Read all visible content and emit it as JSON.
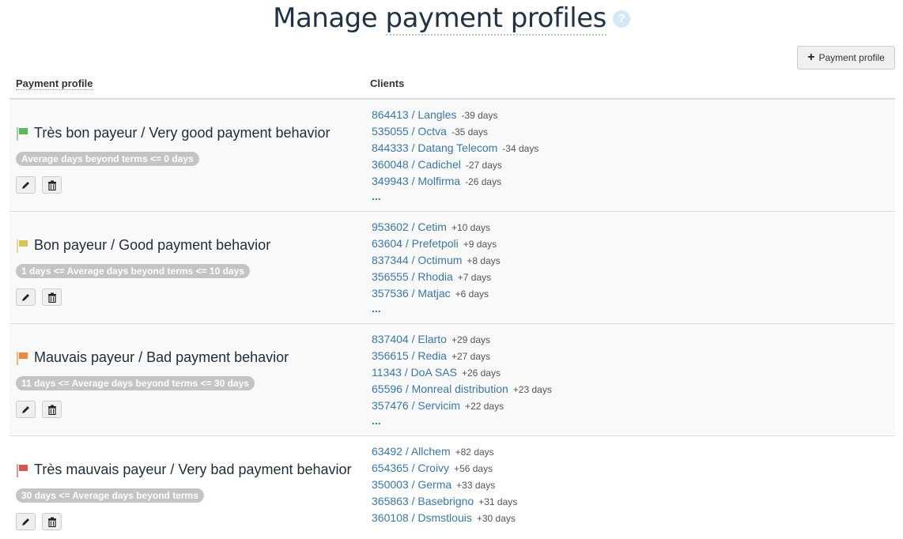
{
  "header": {
    "title_part1": "Manage ",
    "title_part2": "payment profiles",
    "help_icon": "question-circle-icon",
    "help_glyph": "?"
  },
  "toolbar": {
    "add_icon": "plus-icon",
    "add_glyph": "+",
    "add_label": "Payment profile"
  },
  "table": {
    "headers": {
      "profile": "Payment profile",
      "clients": "Clients"
    },
    "more_label": "...",
    "rows": [
      {
        "name": "Très bon payeur / Very good payment behavior",
        "flag_color": "#5cb85c",
        "criteria": "Average days beyond terms <= 0 days",
        "clients": [
          {
            "label": "864413 / Langles",
            "days": "-39 days"
          },
          {
            "label": "535055 / Octva",
            "days": "-35 days"
          },
          {
            "label": "844333 / Datang Telecom",
            "days": "-34 days"
          },
          {
            "label": "360048 / Cadichel",
            "days": "-27 days"
          },
          {
            "label": "349943 / Molfirma",
            "days": "-26 days"
          }
        ],
        "has_more": true
      },
      {
        "name": "Bon payeur / Good payment behavior",
        "flag_color": "#d6c35a",
        "criteria": "1 days <= Average days beyond terms <= 10 days",
        "clients": [
          {
            "label": "953602 / Cetim",
            "days": "+10 days"
          },
          {
            "label": "63604 / Prefetpoli",
            "days": "+9 days"
          },
          {
            "label": "837344 / Octimum",
            "days": "+8 days"
          },
          {
            "label": "356555 / Rhodia",
            "days": "+7 days"
          },
          {
            "label": "357536 / Matjac",
            "days": "+6 days"
          }
        ],
        "has_more": true
      },
      {
        "name": "Mauvais payeur / Bad payment behavior",
        "flag_color": "#f0883c",
        "criteria": "11 days <= Average days beyond terms <= 30 days",
        "clients": [
          {
            "label": "837404 / Elarto",
            "days": "+29 days"
          },
          {
            "label": "356615 / Redia",
            "days": "+27 days"
          },
          {
            "label": "11343 / DoA SAS",
            "days": "+26 days"
          },
          {
            "label": "65596 / Monreal distribution",
            "days": "+23 days"
          },
          {
            "label": "357476 / Servicim",
            "days": "+22 days"
          }
        ],
        "has_more": true
      },
      {
        "name": "Très mauvais payeur / Very bad payment behavior",
        "flag_color": "#d9534f",
        "criteria": "30 days <= Average days beyond terms",
        "clients": [
          {
            "label": "63492 / Allchem",
            "days": "+82 days"
          },
          {
            "label": "654365 / Croivy",
            "days": "+56 days"
          },
          {
            "label": "350003 / Germa",
            "days": "+33 days"
          },
          {
            "label": "365863 / Basebrigno",
            "days": "+31 days"
          },
          {
            "label": "360108 / Dsmstlouis",
            "days": "+30 days"
          }
        ],
        "has_more": false
      }
    ]
  }
}
